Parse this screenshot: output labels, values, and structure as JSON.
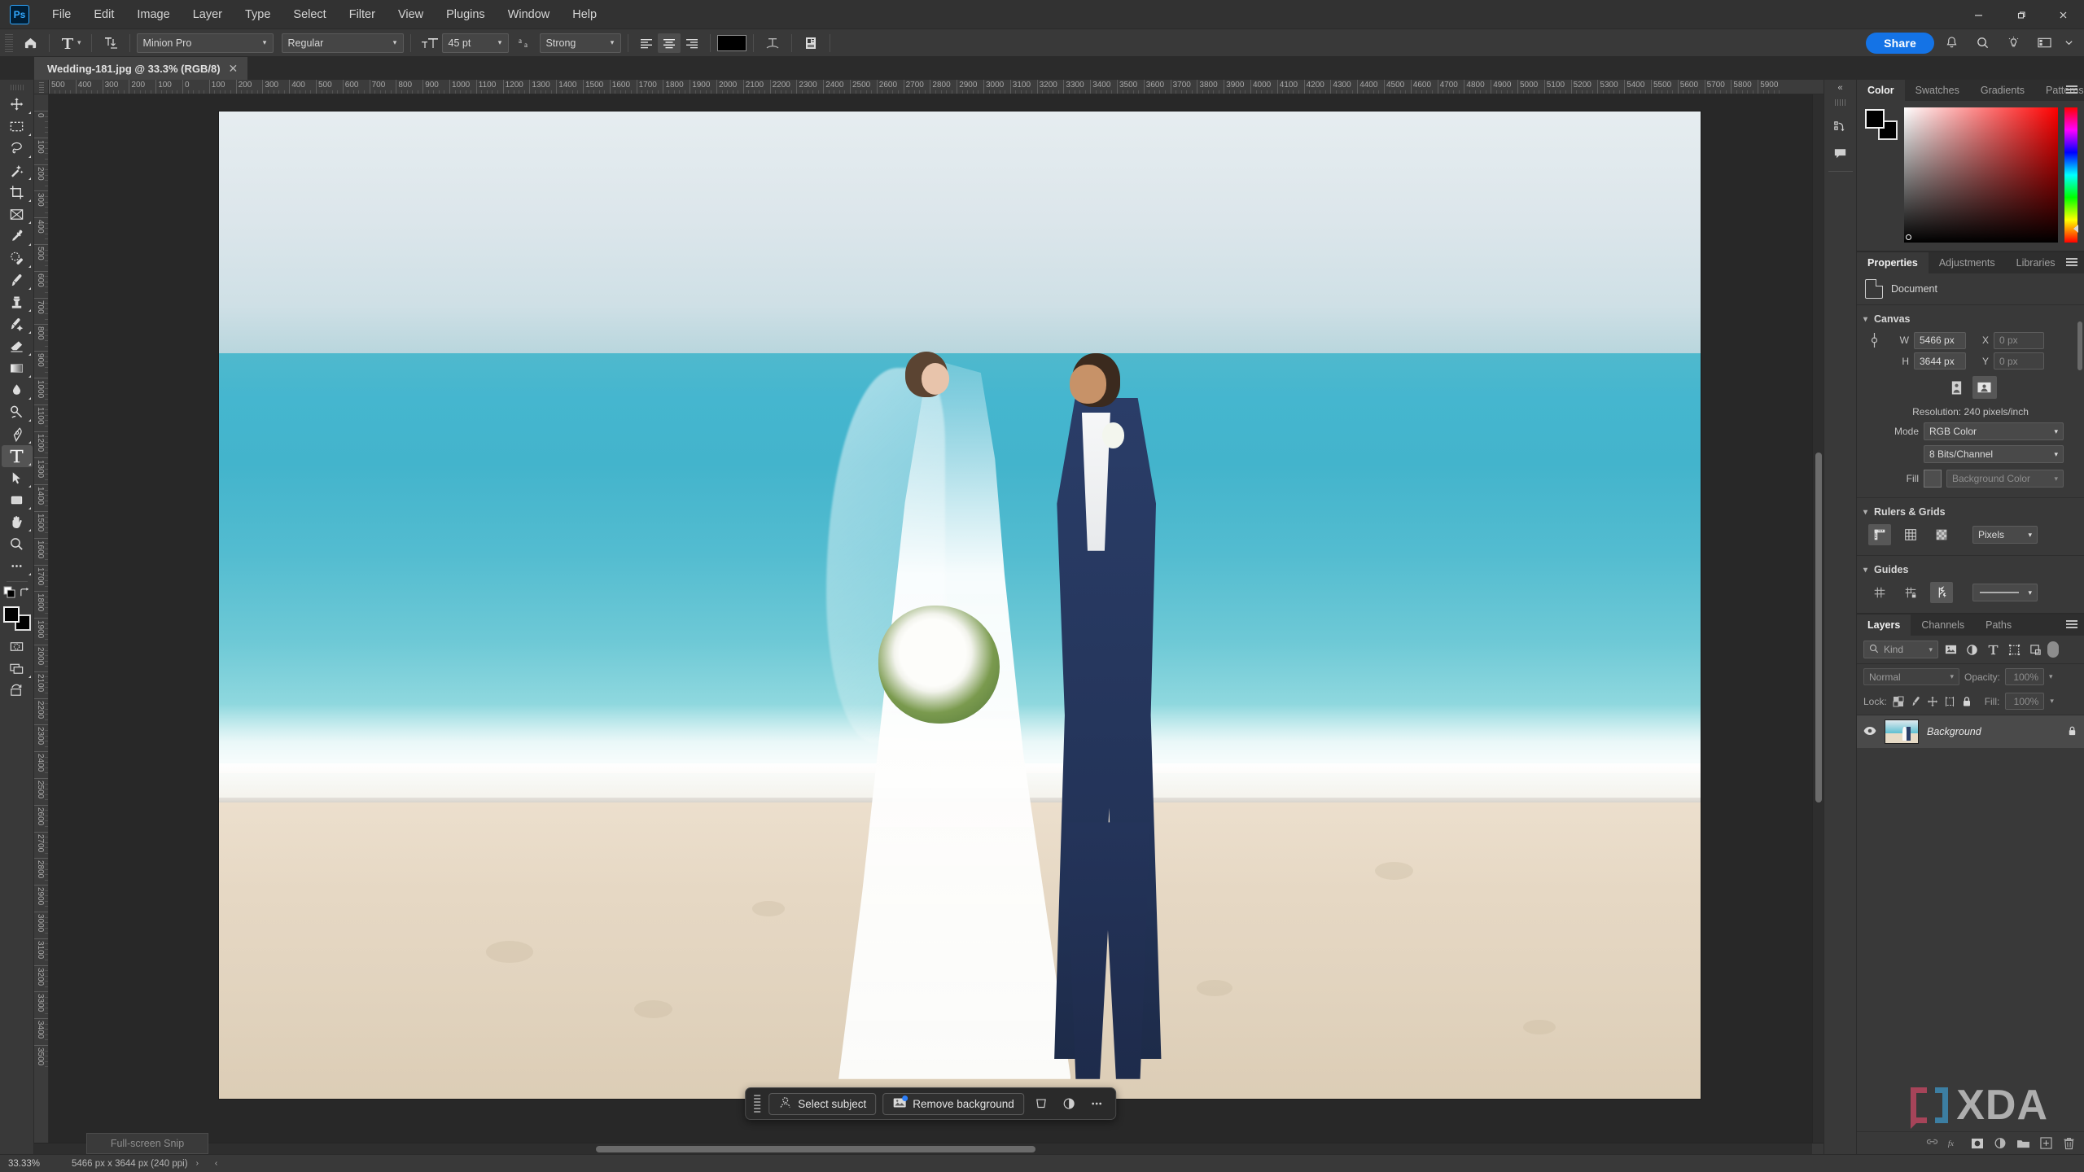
{
  "app": {
    "logo": "Ps",
    "menus": [
      "File",
      "Edit",
      "Image",
      "Layer",
      "Type",
      "Select",
      "Filter",
      "View",
      "Plugins",
      "Window",
      "Help"
    ],
    "window_controls": {
      "minimize": "—",
      "maximize": "❐",
      "close": "✕"
    }
  },
  "options_bar": {
    "home_icon": "home-icon",
    "tool_icon": "type-tool-icon",
    "orientation_icon": "text-orientation-icon",
    "font_family": "Minion Pro",
    "font_style": "Regular",
    "font_size": "45 pt",
    "anti_alias_icon": "anti-alias-icon",
    "anti_alias": "Strong",
    "align": [
      "align-left",
      "align-center",
      "align-right"
    ],
    "align_active": "align-center",
    "text_color": "#000000",
    "warp_icon": "warp-text-icon",
    "panel_icon": "character-panel-icon",
    "share_label": "Share",
    "right_icons": [
      "bell-icon",
      "search-icon",
      "discover-icon",
      "workspace-icon",
      "chevron-down-icon"
    ]
  },
  "document_tab": {
    "title": "Wedding-181.jpg @ 33.3% (RGB/8)",
    "close": "✕"
  },
  "toolbar": {
    "tools": [
      {
        "name": "move-tool",
        "glyph": "move"
      },
      {
        "name": "rectangular-marquee-tool",
        "glyph": "marquee"
      },
      {
        "name": "lasso-tool",
        "glyph": "lasso"
      },
      {
        "name": "object-selection-tool",
        "glyph": "wand"
      },
      {
        "name": "crop-tool",
        "glyph": "crop"
      },
      {
        "name": "frame-tool",
        "glyph": "frame"
      },
      {
        "name": "eyedropper-tool",
        "glyph": "eyedropper"
      },
      {
        "name": "spot-healing-brush-tool",
        "glyph": "healing"
      },
      {
        "name": "brush-tool",
        "glyph": "brush"
      },
      {
        "name": "clone-stamp-tool",
        "glyph": "stamp"
      },
      {
        "name": "history-brush-tool",
        "glyph": "historybrush"
      },
      {
        "name": "eraser-tool",
        "glyph": "eraser"
      },
      {
        "name": "gradient-tool",
        "glyph": "gradient"
      },
      {
        "name": "blur-tool",
        "glyph": "blur"
      },
      {
        "name": "dodge-tool",
        "glyph": "dodge"
      },
      {
        "name": "pen-tool",
        "glyph": "pen"
      },
      {
        "name": "type-tool",
        "glyph": "type"
      },
      {
        "name": "path-selection-tool",
        "glyph": "pathselect"
      },
      {
        "name": "rectangle-tool",
        "glyph": "rect"
      },
      {
        "name": "hand-tool",
        "glyph": "hand"
      },
      {
        "name": "zoom-tool",
        "glyph": "zoom"
      },
      {
        "name": "edit-toolbar-button",
        "glyph": "dots"
      }
    ],
    "active_tool": "type-tool",
    "default_colors_icon": "default-colors-icon",
    "swap_colors_icon": "swap-colors-icon",
    "foreground_color": "#000000",
    "background_color": "#000000",
    "quick_mask_icon": "quick-mask-icon",
    "screen_mode_icon": "screen-mode-icon",
    "share_image_icon": "share-image-icon"
  },
  "rulers": {
    "unit": "px",
    "h_labels": [
      "500",
      "400",
      "300",
      "200",
      "100",
      "0",
      "100",
      "200",
      "300",
      "400",
      "500",
      "600",
      "700",
      "800",
      "900",
      "1000",
      "1100",
      "1200",
      "1300",
      "1400",
      "1500",
      "1600",
      "1700",
      "1800",
      "1900",
      "2000",
      "2100",
      "2200",
      "2300",
      "2400",
      "2500",
      "2600",
      "2700",
      "2800",
      "2900",
      "3000",
      "3100",
      "3200",
      "3300",
      "3400",
      "3500",
      "3600",
      "3700",
      "3800",
      "3900",
      "4000",
      "4100",
      "4200",
      "4300",
      "4400",
      "4500",
      "4600",
      "4700",
      "4800",
      "4900",
      "5000",
      "5100",
      "5200",
      "5300",
      "5400",
      "5500",
      "5600",
      "5700",
      "5800",
      "5900"
    ],
    "v_labels": [
      "0",
      "100",
      "200",
      "300",
      "400",
      "500",
      "600",
      "700",
      "800",
      "900",
      "1000",
      "1100",
      "1200",
      "1300",
      "1400",
      "1500",
      "1600",
      "1700",
      "1800",
      "1900",
      "2000",
      "2100",
      "2200",
      "2300",
      "2400",
      "2500",
      "2600",
      "2700",
      "2800",
      "2900",
      "3000",
      "3100",
      "3200",
      "3300",
      "3400",
      "3500"
    ]
  },
  "right_rail": {
    "collapse_icon": "collapse-panels-icon",
    "icons": [
      "history-icon",
      "comments-icon"
    ]
  },
  "color_panel": {
    "tabs": [
      "Color",
      "Swatches",
      "Gradients",
      "Patterns"
    ],
    "active_tab": "Color",
    "foreground": "#000000",
    "background": "#000000",
    "menu_icon": "panel-menu-icon"
  },
  "properties_panel": {
    "tabs": [
      "Properties",
      "Adjustments",
      "Libraries"
    ],
    "active_tab": "Properties",
    "menu_icon": "panel-menu-icon",
    "doc_label": "Document",
    "canvas": {
      "heading": "Canvas",
      "w_label": "W",
      "w_value": "5466 px",
      "x_label": "X",
      "x_value": "0 px",
      "h_label": "H",
      "h_value": "3644 px",
      "y_label": "Y",
      "y_value": "0 px",
      "link_icon": "link-dimensions-icon",
      "portrait_icon": "portrait-orientation-icon",
      "landscape_icon": "landscape-orientation-icon",
      "orientation_active": "landscape",
      "resolution": "Resolution: 240 pixels/inch",
      "mode_label": "Mode",
      "mode_value": "RGB Color",
      "depth_value": "8 Bits/Channel",
      "fill_label": "Fill",
      "fill_color": "#4e4e4e",
      "fill_value": "Background Color"
    },
    "rulers_grids": {
      "heading": "Rulers & Grids",
      "icons": [
        "rulers-icon",
        "grid-icon",
        "transparency-grid-icon"
      ],
      "active_icon": "rulers-icon",
      "unit_value": "Pixels"
    },
    "guides": {
      "heading": "Guides",
      "icons": [
        "show-guides-icon",
        "lock-guides-icon",
        "smart-guides-icon"
      ],
      "active_icon": "smart-guides-icon",
      "style_value": "guide-line-style"
    }
  },
  "layers_panel": {
    "tabs": [
      "Layers",
      "Channels",
      "Paths"
    ],
    "active_tab": "Layers",
    "menu_icon": "panel-menu-icon",
    "filter_placeholder": "Kind",
    "filter_icons": [
      "pixel-filter-icon",
      "adjustment-filter-icon",
      "type-filter-icon",
      "shape-filter-icon",
      "smartobject-filter-icon"
    ],
    "filter_toggle": "filter-enable-toggle",
    "blend_mode": "Normal",
    "opacity_label": "Opacity:",
    "opacity_value": "100%",
    "lock_label": "Lock:",
    "lock_icons": [
      "lock-transparency-icon",
      "lock-image-icon",
      "lock-position-icon",
      "lock-artboard-icon",
      "lock-all-icon"
    ],
    "fill_label": "Fill:",
    "fill_value": "100%",
    "layers": [
      {
        "name": "Background",
        "visible": true,
        "locked": true,
        "visibility_icon": "eye-icon",
        "lock_icon": "lock-icon"
      }
    ],
    "bottom_icons": [
      "link-layers-icon",
      "layer-style-icon",
      "layer-mask-icon",
      "adjustment-layer-icon",
      "new-group-icon",
      "new-layer-icon",
      "delete-layer-icon"
    ]
  },
  "contextual_task_bar": {
    "grip_icon": "drag-handle-icon",
    "buttons": [
      {
        "label": "Select subject",
        "icon": "select-subject-icon"
      },
      {
        "label": "Remove background",
        "icon": "remove-background-icon",
        "badge": true
      }
    ],
    "icons": [
      "transform-icon",
      "adjustment-icon",
      "more-options-icon"
    ]
  },
  "status_bar": {
    "zoom": "33.33%",
    "doc_size": "5466 px x 3644 px (240 ppi)",
    "expand_icon": "›",
    "collapse_icon": "‹"
  },
  "snip_overlay": {
    "label": "Full-screen Snip"
  },
  "watermark": {
    "text": "XDA",
    "bracket_left_color": "#b0455c",
    "bracket_right_color": "#3d84ab"
  },
  "photo": {
    "description": "wedding-couple-on-beach",
    "alt": "Bride and groom embracing on a white sand beach with turquoise ocean"
  }
}
